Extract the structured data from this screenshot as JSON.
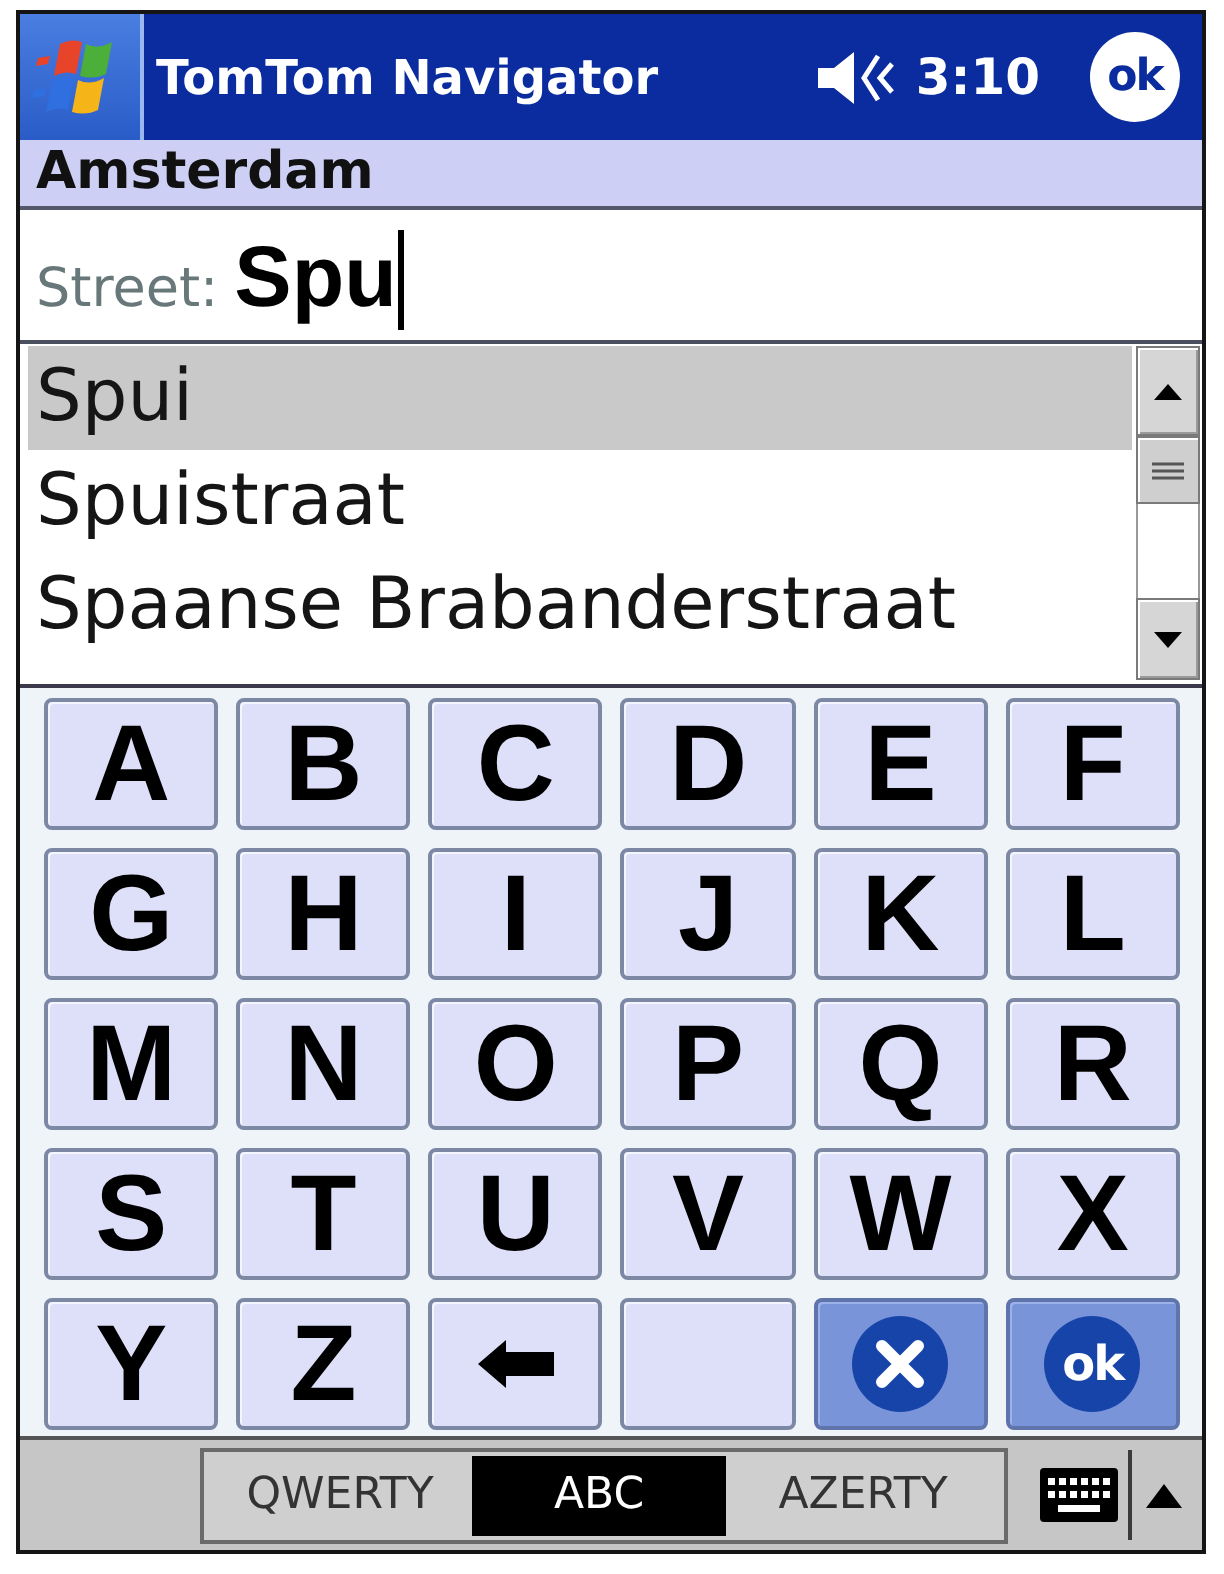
{
  "title_bar": {
    "title": "TomTom Navigator",
    "time": "3:10",
    "ok": "ok"
  },
  "city": {
    "name": "Amsterdam"
  },
  "street_field": {
    "label": "Street:",
    "value": "Spu"
  },
  "results": [
    {
      "name": "Spui",
      "selected": true
    },
    {
      "name": "Spuistraat",
      "selected": false
    },
    {
      "name": "Spaanse Brabanderstraat",
      "selected": false
    }
  ],
  "keys": [
    {
      "kind": "letter",
      "label": "A"
    },
    {
      "kind": "letter",
      "label": "B"
    },
    {
      "kind": "letter",
      "label": "C"
    },
    {
      "kind": "letter",
      "label": "D"
    },
    {
      "kind": "letter",
      "label": "E"
    },
    {
      "kind": "letter",
      "label": "F"
    },
    {
      "kind": "letter",
      "label": "G"
    },
    {
      "kind": "letter",
      "label": "H"
    },
    {
      "kind": "letter",
      "label": "I"
    },
    {
      "kind": "letter",
      "label": "J"
    },
    {
      "kind": "letter",
      "label": "K"
    },
    {
      "kind": "letter",
      "label": "L"
    },
    {
      "kind": "letter",
      "label": "M"
    },
    {
      "kind": "letter",
      "label": "N"
    },
    {
      "kind": "letter",
      "label": "O"
    },
    {
      "kind": "letter",
      "label": "P"
    },
    {
      "kind": "letter",
      "label": "Q"
    },
    {
      "kind": "letter",
      "label": "R"
    },
    {
      "kind": "letter",
      "label": "S"
    },
    {
      "kind": "letter",
      "label": "T"
    },
    {
      "kind": "letter",
      "label": "U"
    },
    {
      "kind": "letter",
      "label": "V"
    },
    {
      "kind": "letter",
      "label": "W"
    },
    {
      "kind": "letter",
      "label": "X"
    },
    {
      "kind": "letter",
      "label": "Y"
    },
    {
      "kind": "letter",
      "label": "Z"
    },
    {
      "kind": "backspace"
    },
    {
      "kind": "blank"
    },
    {
      "kind": "cancel"
    },
    {
      "kind": "ok",
      "label": "ok"
    }
  ],
  "layouts": [
    {
      "label": "QWERTY",
      "selected": false
    },
    {
      "label": "ABC",
      "selected": true
    },
    {
      "label": "AZERTY",
      "selected": false
    }
  ]
}
